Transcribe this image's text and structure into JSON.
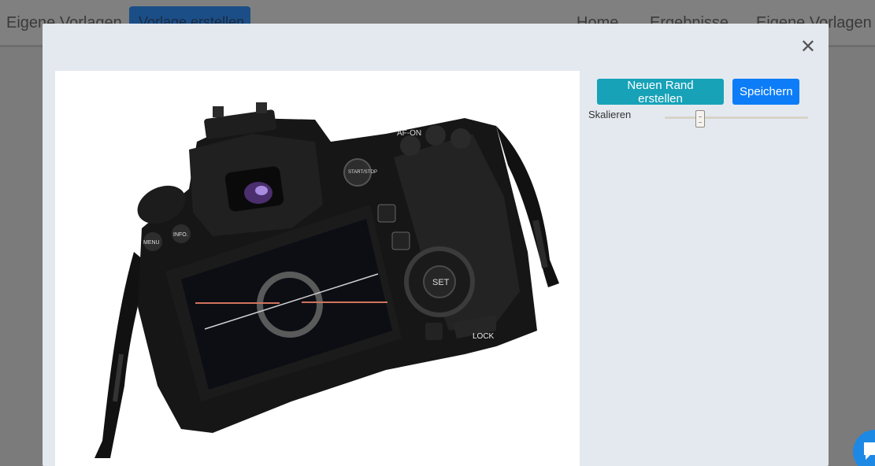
{
  "navbar": {
    "left_link": "Eigene Vorlagen",
    "create_button": "Vorlage erstellen",
    "right_links": [
      "Home",
      "Ergebnisse",
      "Eigene Vorlagen"
    ]
  },
  "modal": {
    "close_symbol": "✕",
    "buttons": {
      "new_border": "Neuen Rand erstellen",
      "save": "Speichern"
    },
    "scale_label": "Skalieren",
    "scale_value": 0.23
  },
  "camera": {
    "labels": [
      "AF-ON",
      "START/STOP",
      "MENU",
      "INFO.",
      "SET",
      "LOCK"
    ]
  },
  "colors": {
    "teal": "#17a2b8",
    "blue": "#0d7df7"
  },
  "icons": [
    "close-icon",
    "chat-icon",
    "camera-image"
  ]
}
